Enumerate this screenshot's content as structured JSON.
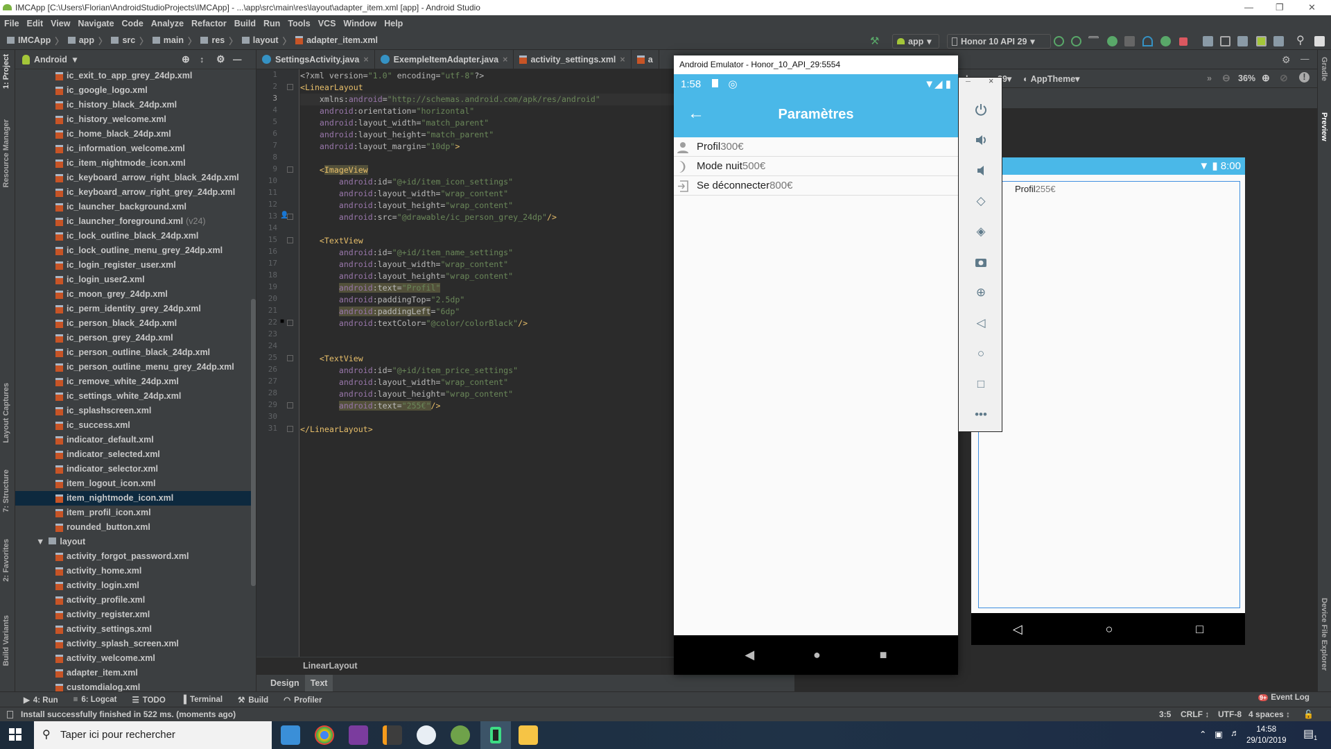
{
  "window": {
    "title": "IMCApp [C:\\Users\\Florian\\AndroidStudioProjects\\IMCApp] - ...\\app\\src\\main\\res\\layout\\adapter_item.xml [app] - Android Studio"
  },
  "menu": [
    "File",
    "Edit",
    "View",
    "Navigate",
    "Code",
    "Analyze",
    "Refactor",
    "Build",
    "Run",
    "Tools",
    "VCS",
    "Window",
    "Help"
  ],
  "breadcrumb": [
    "IMCApp",
    "app",
    "src",
    "main",
    "res",
    "layout",
    "adapter_item.xml"
  ],
  "toolbar": {
    "run_config": "app",
    "device": "Honor 10 API 29"
  },
  "left_strip": [
    "1: Project",
    "Resource Manager",
    "Layout Captures",
    "7: Structure",
    "2: Favorites",
    "Build Variants"
  ],
  "right_strip": [
    "Gradle",
    "Preview",
    "Device File Explorer"
  ],
  "project": {
    "view": "Android",
    "items": [
      {
        "label": "ic_exit_to_app_grey_24dp.xml"
      },
      {
        "label": "ic_google_logo.xml"
      },
      {
        "label": "ic_history_black_24dp.xml"
      },
      {
        "label": "ic_history_welcome.xml"
      },
      {
        "label": "ic_home_black_24dp.xml"
      },
      {
        "label": "ic_information_welcome.xml"
      },
      {
        "label": "ic_item_nightmode_icon.xml"
      },
      {
        "label": "ic_keyboard_arrow_right_black_24dp.xml"
      },
      {
        "label": "ic_keyboard_arrow_right_grey_24dp.xml"
      },
      {
        "label": "ic_launcher_background.xml"
      },
      {
        "label": "ic_launcher_foreground.xml",
        "suffix": "(v24)"
      },
      {
        "label": "ic_lock_outline_black_24dp.xml"
      },
      {
        "label": "ic_lock_outline_menu_grey_24dp.xml"
      },
      {
        "label": "ic_login_register_user.xml"
      },
      {
        "label": "ic_login_user2.xml"
      },
      {
        "label": "ic_moon_grey_24dp.xml"
      },
      {
        "label": "ic_perm_identity_grey_24dp.xml"
      },
      {
        "label": "ic_person_black_24dp.xml"
      },
      {
        "label": "ic_person_grey_24dp.xml"
      },
      {
        "label": "ic_person_outline_black_24dp.xml"
      },
      {
        "label": "ic_person_outline_menu_grey_24dp.xml"
      },
      {
        "label": "ic_remove_white_24dp.xml"
      },
      {
        "label": "ic_settings_white_24dp.xml"
      },
      {
        "label": "ic_splashscreen.xml"
      },
      {
        "label": "ic_success.xml"
      },
      {
        "label": "indicator_default.xml"
      },
      {
        "label": "indicator_selected.xml"
      },
      {
        "label": "indicator_selector.xml"
      },
      {
        "label": "item_logout_icon.xml"
      },
      {
        "label": "item_nightmode_icon.xml",
        "selected": true
      },
      {
        "label": "item_profil_icon.xml"
      },
      {
        "label": "rounded_button.xml"
      },
      {
        "label": "layout",
        "folder": true
      },
      {
        "label": "activity_forgot_password.xml"
      },
      {
        "label": "activity_home.xml"
      },
      {
        "label": "activity_login.xml"
      },
      {
        "label": "activity_profile.xml"
      },
      {
        "label": "activity_register.xml"
      },
      {
        "label": "activity_settings.xml"
      },
      {
        "label": "activity_splash_screen.xml"
      },
      {
        "label": "activity_welcome.xml"
      },
      {
        "label": "adapter_item.xml"
      },
      {
        "label": "customdialog.xml"
      }
    ]
  },
  "tabs": [
    "SettingsActivity.java",
    "ExempleItemAdapter.java",
    "activity_settings.xml",
    "a"
  ],
  "code": [
    [
      [
        "p",
        "<?xml version="
      ],
      [
        "s",
        "\"1.0\""
      ],
      [
        "p",
        " encoding="
      ],
      [
        "s",
        "\"utf-8\""
      ],
      [
        "p",
        "?>"
      ]
    ],
    [
      [
        "t",
        "<LinearLayout"
      ]
    ],
    [
      [
        "a",
        "    xmlns:"
      ],
      [
        "n",
        "android"
      ],
      [
        "p",
        "="
      ],
      [
        "s",
        "\"http://schemas.android.com/apk/res/android\""
      ]
    ],
    [
      [
        "n",
        "    android"
      ],
      [
        "a",
        ":orientation="
      ],
      [
        "s",
        "\"horizontal\""
      ]
    ],
    [
      [
        "n",
        "    android"
      ],
      [
        "a",
        ":layout_width="
      ],
      [
        "s",
        "\"match_parent\""
      ]
    ],
    [
      [
        "n",
        "    android"
      ],
      [
        "a",
        ":layout_height="
      ],
      [
        "s",
        "\"match_parent\""
      ]
    ],
    [
      [
        "n",
        "    android"
      ],
      [
        "a",
        ":layout_margin="
      ],
      [
        "s",
        "\"10dp\""
      ],
      [
        "t",
        ">"
      ]
    ],
    [],
    [
      [
        "t",
        "    <"
      ],
      [
        "t hl",
        "ImageView"
      ]
    ],
    [
      [
        "n",
        "        android"
      ],
      [
        "a",
        ":id="
      ],
      [
        "s",
        "\"@+id/item_icon_settings\""
      ]
    ],
    [
      [
        "n",
        "        android"
      ],
      [
        "a",
        ":layout_width="
      ],
      [
        "s",
        "\"wrap_content\""
      ]
    ],
    [
      [
        "n",
        "        android"
      ],
      [
        "a",
        ":layout_height="
      ],
      [
        "s",
        "\"wrap_content\""
      ]
    ],
    [
      [
        "n",
        "        android"
      ],
      [
        "a",
        ":src="
      ],
      [
        "s",
        "\"@drawable/ic_person_grey_24dp\""
      ],
      [
        "t",
        "/>"
      ]
    ],
    [],
    [
      [
        "t",
        "    <TextView"
      ]
    ],
    [
      [
        "n",
        "        android"
      ],
      [
        "a",
        ":id="
      ],
      [
        "s",
        "\"@+id/item_name_settings\""
      ]
    ],
    [
      [
        "n",
        "        android"
      ],
      [
        "a",
        ":layout_width="
      ],
      [
        "s",
        "\"wrap_content\""
      ]
    ],
    [
      [
        "n",
        "        android"
      ],
      [
        "a",
        ":layout_height="
      ],
      [
        "s",
        "\"wrap_content\""
      ]
    ],
    [
      [
        "p",
        "        "
      ],
      [
        "n hl",
        "android"
      ],
      [
        "a hl",
        ":text="
      ],
      [
        "s hl",
        "\"Profil\""
      ]
    ],
    [
      [
        "n",
        "        android"
      ],
      [
        "a",
        ":paddingTop="
      ],
      [
        "s",
        "\"2.5dp\""
      ]
    ],
    [
      [
        "p",
        "        "
      ],
      [
        "n hl",
        "android"
      ],
      [
        "a hl",
        ":paddingLeft"
      ],
      [
        "a",
        "="
      ],
      [
        "s",
        "\"6dp\""
      ]
    ],
    [
      [
        "n",
        "        android"
      ],
      [
        "a",
        ":textColor="
      ],
      [
        "s",
        "\"@color/colorBlack\""
      ],
      [
        "t",
        "/>"
      ]
    ],
    [],
    [],
    [
      [
        "t",
        "    <TextView"
      ]
    ],
    [
      [
        "n",
        "        android"
      ],
      [
        "a",
        ":id="
      ],
      [
        "s",
        "\"@+id/item_price_settings\""
      ]
    ],
    [
      [
        "n",
        "        android"
      ],
      [
        "a",
        ":layout_width="
      ],
      [
        "s",
        "\"wrap_content\""
      ]
    ],
    [
      [
        "n",
        "        android"
      ],
      [
        "a",
        ":layout_height="
      ],
      [
        "s",
        "\"wrap_content\""
      ]
    ],
    [
      [
        "p",
        "        "
      ],
      [
        "n hl",
        "android"
      ],
      [
        "a hl",
        ":text="
      ],
      [
        "s hl",
        "\"255€\""
      ],
      [
        "t",
        "/>"
      ]
    ],
    [],
    [
      [
        "t",
        "</LinearLayout>"
      ]
    ]
  ],
  "current_line": 3,
  "editor": {
    "breadcrumb": "LinearLayout",
    "modes": [
      "Design",
      "Text"
    ],
    "active_mode": "Text"
  },
  "design": {
    "device_partial": "el",
    "api": "29",
    "theme": "AppTheme",
    "zoom": "36%",
    "preview_time": "8:00",
    "preview_name": "Profil",
    "preview_price": "255€"
  },
  "emulator": {
    "title": "Android Emulator - Honor_10_API_29:5554",
    "time": "1:58",
    "screen_title": "Paramètres",
    "rows": [
      {
        "name": "Profil",
        "price": "300€",
        "icon": "person-icon"
      },
      {
        "name": "Mode nuit",
        "price": "500€",
        "icon": "moon-icon"
      },
      {
        "name": "Se déconnecter",
        "price": "800€",
        "icon": "logout-icon"
      }
    ],
    "controls": [
      "power",
      "volume-up",
      "volume-down",
      "rotate-left",
      "rotate-right",
      "screenshot",
      "zoom",
      "back",
      "home",
      "overview",
      "more"
    ]
  },
  "toolwindows": [
    "4: Run",
    "6: Logcat",
    "TODO",
    "Terminal",
    "Build",
    "Profiler"
  ],
  "event_log": {
    "label": "Event Log",
    "badge": "9+"
  },
  "status": {
    "message": "Install successfully finished in 522 ms. (moments ago)",
    "position": "3:5",
    "line_sep": "CRLF",
    "encoding": "UTF-8",
    "indent": "4 spaces"
  },
  "taskbar": {
    "search_placeholder": "Taper ici pour rechercher",
    "time": "14:58",
    "date": "29/10/2019",
    "notifications": "1"
  },
  "colors": {
    "accent": "#4ab8e8",
    "selection": "#0d293e",
    "editor_bg": "#2b2b2b"
  }
}
